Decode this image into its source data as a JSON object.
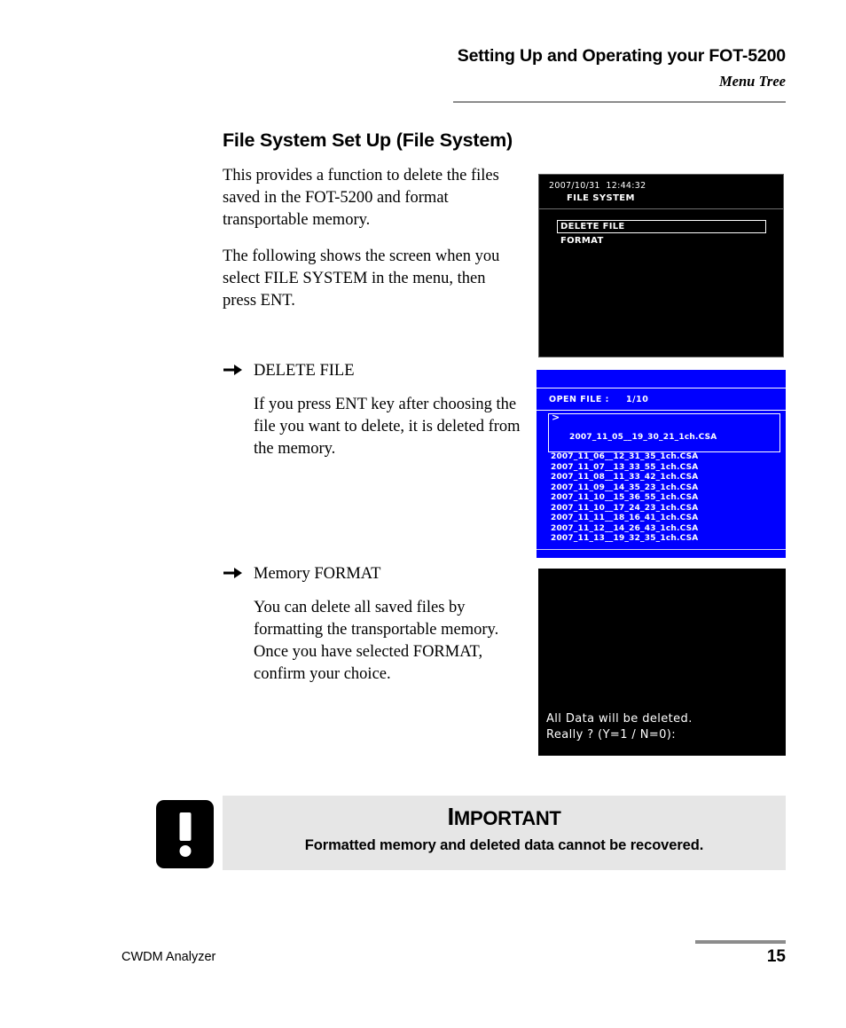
{
  "header": {
    "title": "Setting Up and Operating your FOT-5200",
    "subtitle": "Menu Tree"
  },
  "section": {
    "title": "File System Set Up (File System)",
    "paragraphs": [
      "This provides a function to delete the files saved in the FOT-5200 and format transportable memory.",
      "The following shows the screen when you select FILE SYSTEM in the menu, then press ENT."
    ]
  },
  "bullets": [
    {
      "heading": "DELETE FILE",
      "body": "If you press ENT key after choosing the file you want to delete, it is deleted from the memory."
    },
    {
      "heading": "Memory FORMAT",
      "body": "You can delete all saved files by formatting the transportable memory. Once you have selected FORMAT, confirm your choice."
    }
  ],
  "screens": {
    "file_system": {
      "status_line": "2007/10/31  12:44:32",
      "screen_name": "FILE SYSTEM",
      "menu_items": [
        {
          "label": "DELETE FILE",
          "selected": true
        },
        {
          "label": "FORMAT",
          "selected": false
        }
      ]
    },
    "open_file": {
      "header_label": "OPEN FILE :",
      "page_indicator": "1/10",
      "cursor_glyph": ">",
      "files": [
        {
          "name": "2007_11_05__19_30_21_1ch.CSA",
          "selected": true
        },
        {
          "name": "2007_11_06__12_31_35_1ch.CSA",
          "selected": false
        },
        {
          "name": "2007_11_07__13_33_55_1ch.CSA",
          "selected": false
        },
        {
          "name": "2007_11_08__11_33_42_1ch.CSA",
          "selected": false
        },
        {
          "name": "2007_11_09__14_35_23_1ch.CSA",
          "selected": false
        },
        {
          "name": "2007_11_10__15_36_55_1ch.CSA",
          "selected": false
        },
        {
          "name": "2007_11_10__17_24_23_1ch.CSA",
          "selected": false
        },
        {
          "name": "2007_11_11__18_16_41_1ch.CSA",
          "selected": false
        },
        {
          "name": "2007_11_12__14_26_43_1ch.CSA",
          "selected": false
        },
        {
          "name": "2007_11_13__19_32_35_1ch.CSA",
          "selected": false
        }
      ]
    },
    "format_confirm": {
      "line1": "All Data will be deleted.",
      "line2": "Really ? (Y=1 / N=0):"
    }
  },
  "important": {
    "title_first_letter": "I",
    "title_rest": "MPORTANT",
    "text": "Formatted memory and deleted data cannot be recovered.",
    "icon": "exclamation-icon"
  },
  "footer": {
    "product": "CWDM Analyzer",
    "page_number": "15"
  },
  "colors": {
    "screen_black": "#000000",
    "screen_blue": "#0000ff",
    "screen_text": "#ffffff",
    "callout_panel": "#e6e6e6",
    "rule_gray": "#8c8c8c"
  }
}
